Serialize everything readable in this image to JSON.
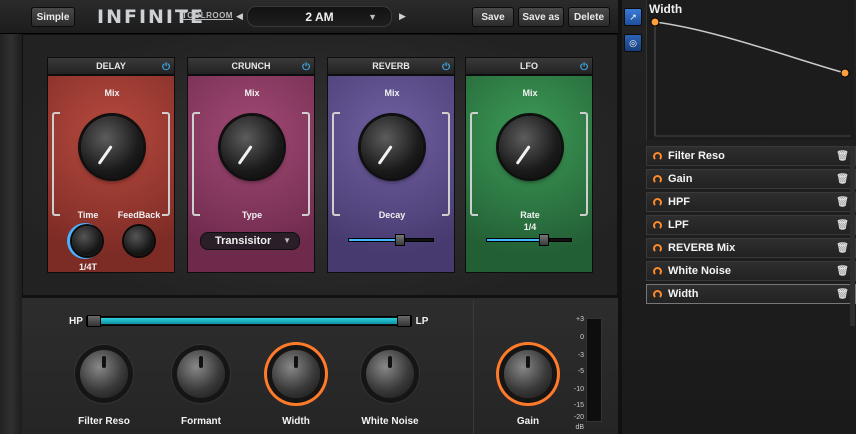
{
  "header": {
    "simple_label": "Simple",
    "app_name": "INFINITE",
    "brand": "TOOLROOM",
    "preset_name": "2 AM",
    "save_label": "Save",
    "save_as_label": "Save as",
    "delete_label": "Delete"
  },
  "modules": [
    {
      "title": "DELAY",
      "top_label": "Mix",
      "controls": [
        {
          "label": "Time",
          "value": "1/4T"
        },
        {
          "label": "FeedBack"
        }
      ],
      "color": "#9d3a32"
    },
    {
      "title": "CRUNCH",
      "top_label": "Mix",
      "controls": [
        {
          "label": "Type",
          "value": "Transisitor"
        }
      ],
      "color": "#8b3a61"
    },
    {
      "title": "REVERB",
      "top_label": "Mix",
      "controls": [
        {
          "label": "Decay"
        }
      ],
      "color": "#5c4a87"
    },
    {
      "title": "LFO",
      "top_label": "Mix",
      "controls": [
        {
          "label": "Rate",
          "value": "1/4"
        }
      ],
      "color": "#2f7f47"
    }
  ],
  "bottom": {
    "hp_label": "HP",
    "lp_label": "LP",
    "knobs": [
      "Filter Reso",
      "Formant",
      "Width",
      "White Noise"
    ],
    "gain_label": "Gain",
    "meter_scale": [
      "+3",
      "0",
      "-3",
      "-5",
      "-10",
      "-15",
      "-20",
      "dB"
    ]
  },
  "right_panel": {
    "graph_title": "Width",
    "mod_items": [
      "Filter Reso",
      "Gain",
      "HPF",
      "LPF",
      "REVERB Mix",
      "White Noise",
      "Width"
    ],
    "selected_item": "Width"
  },
  "colors": {
    "accent_orange": "#ff7b2a",
    "accent_blue": "#3fa7e6",
    "delay": "#9d3a32",
    "crunch": "#8b3a61",
    "reverb": "#5c4a87",
    "lfo": "#2f7f47"
  }
}
